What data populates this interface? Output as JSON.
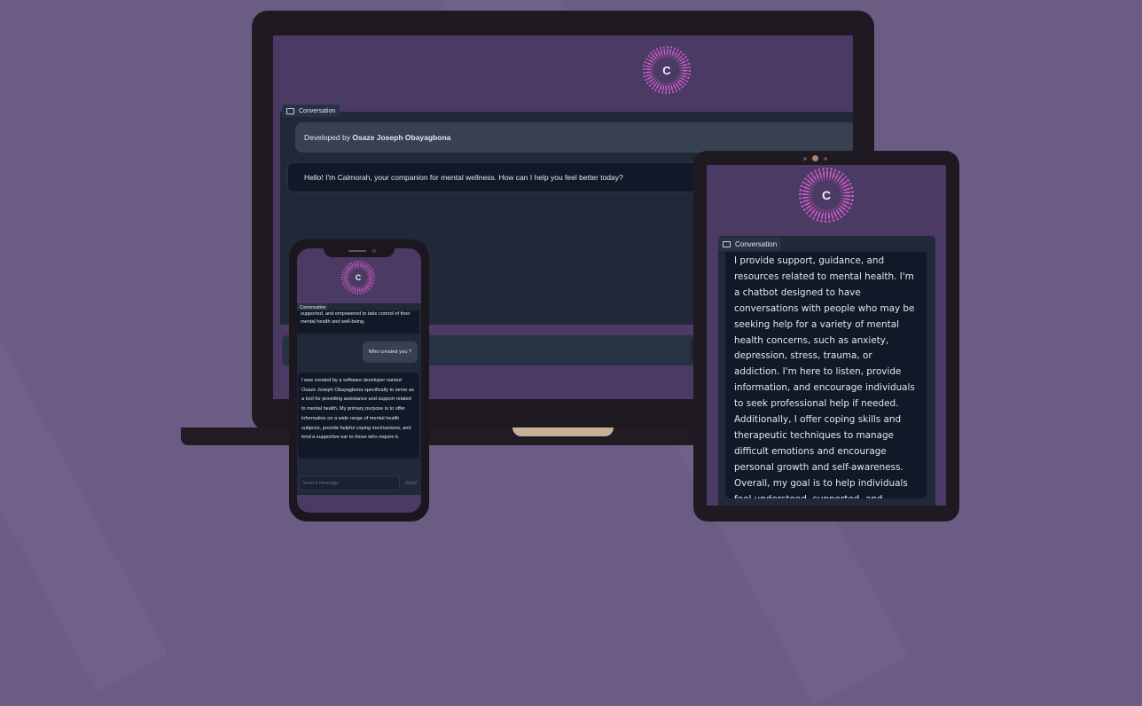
{
  "logo_letter": "C",
  "laptop": {
    "tab_label": "Conversation",
    "developer_prefix": "Developed by ",
    "developer_name": "Osaze Joseph Obayagbona",
    "greeting": "Hello! I'm Calmorah, your companion for mental wellness. How can I help you feel better today?"
  },
  "tablet": {
    "tab_label": "Conversation",
    "message": "I provide support, guidance, and resources related to mental health. I'm a chatbot designed to have conversations with people who may be seeking help for a variety of mental health concerns, such as anxiety, depression, stress, trauma, or addiction. I'm here to listen, provide information, and encourage individuals to seek professional help if needed. Additionally, I offer coping skills and therapeutic techniques to manage difficult emotions and encourage personal growth and self-awareness. Overall, my goal is to help individuals feel understood, supported, and empowered to take control of their mental health and well-being."
  },
  "phone": {
    "tab_label": "Conversation",
    "prev_message_tail": "supported, and empowered to take control of their mental health and well-being.",
    "user_message": "Who created you ?",
    "bot_message": "I was created by a software developer named Osaze Joseph Obayagbona specifically to serve as a tool for providing assistance and support related to mental health. My primary purpose is to offer information on a wide range of mental health subjects, provide helpful coping mechanisms, and lend a supportive ear to those who require it.",
    "input_placeholder": "Send a message",
    "send_label": "Send"
  },
  "colors": {
    "background": "#6b5c84",
    "screen": "#4b3a63",
    "panel": "#1f2937",
    "logo_accent": "#d05cc8"
  }
}
